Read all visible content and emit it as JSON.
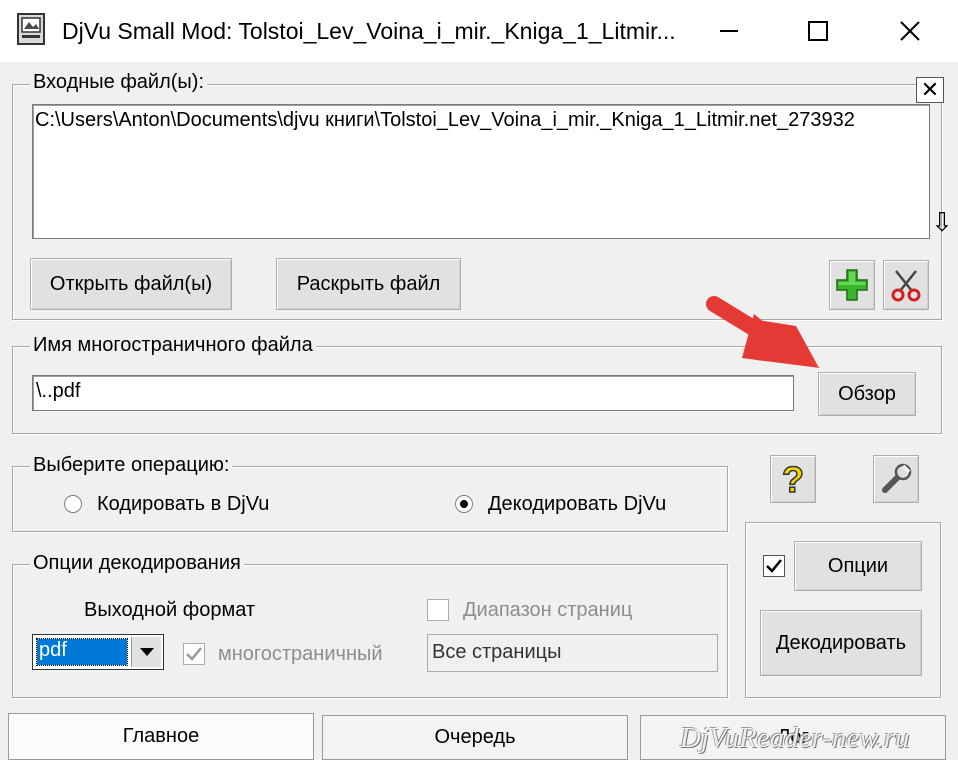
{
  "window": {
    "title": "DjVu Small Mod: Tolstoi_Lev_Voina_i_mir._Kniga_1_Litmir...",
    "controls": [
      "minimize-icon",
      "maximize-icon",
      "close-icon"
    ]
  },
  "input_files": {
    "legend": "Входные файл(ы):",
    "path": "C:\\Users\\Anton\\Documents\\djvu книги\\Tolstoi_Lev_Voina_i_mir._Kniga_1_Litmir.net_273932",
    "clear_button": "✕",
    "down_button": "⇩",
    "open_button": "Открыть файл(ы)",
    "expand_button": "Раскрыть файл",
    "add_icon": "plus-icon",
    "remove_icon": "scissors-icon"
  },
  "multipage": {
    "legend": "Имя многостраничного файла",
    "value": "\\..pdf",
    "browse_button": "Обзор"
  },
  "operation": {
    "legend": "Выберите операцию:",
    "encode_label": "Кодировать в DjVu",
    "decode_label": "Декодировать DjVu",
    "selected": "decode"
  },
  "toolbar": {
    "help_icon": "help-question-icon",
    "settings_icon": "wrench-icon"
  },
  "decode_options": {
    "legend": "Опции декодирования",
    "output_format_label": "Выходной формат",
    "format_value": "pdf",
    "multipage_label": "многостраничный",
    "multipage_checked": true,
    "page_range_label": "Диапазон страниц",
    "page_range_checked": false,
    "pages_value": "Все страницы"
  },
  "actions": {
    "options_checked": true,
    "options_button": "Опции",
    "decode_button": "Декодировать"
  },
  "tabs": [
    "Главное",
    "Очередь",
    "Лог"
  ],
  "watermark": "DjVuReader-new.ru",
  "colors": {
    "arrow": "#e53935",
    "selection": "#0078d7",
    "plus": "#2e9e1f",
    "help": "#f2d600"
  }
}
